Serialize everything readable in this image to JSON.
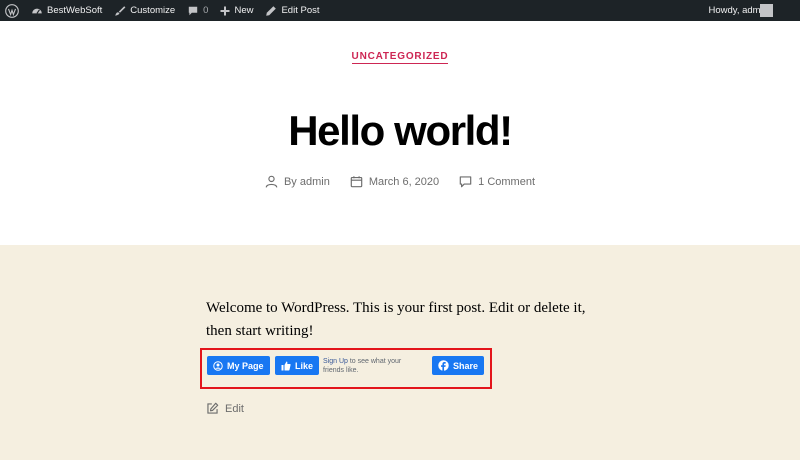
{
  "adminbar": {
    "site_name": "BestWebSoft",
    "customize": "Customize",
    "comments_count": "0",
    "new_label": "New",
    "edit_post": "Edit Post",
    "howdy": "Howdy, admin",
    "icons": [
      "wordpress-icon",
      "dashboard-icon",
      "brush-icon",
      "comment-icon",
      "plus-icon",
      "pencil-icon",
      "avatar"
    ]
  },
  "post": {
    "category": "UNCATEGORIZED",
    "title": "Hello world!",
    "author": "By admin",
    "date": "March 6, 2020",
    "comments": "1 Comment",
    "body": "Welcome to WordPress. This is your first post. Edit or delete it, then start writing!"
  },
  "facebook": {
    "my_page": "My Page",
    "like": "Like",
    "signup_link": "Sign Up",
    "signup_text": " to see what your friends like.",
    "share": "Share"
  },
  "edit_label": "Edit",
  "colors": {
    "adminbar_bg": "#1d2327",
    "accent": "#cd2653",
    "content_bg": "#f5efe0",
    "facebook_blue": "#1877f2",
    "highlight_border": "#e3141b"
  }
}
